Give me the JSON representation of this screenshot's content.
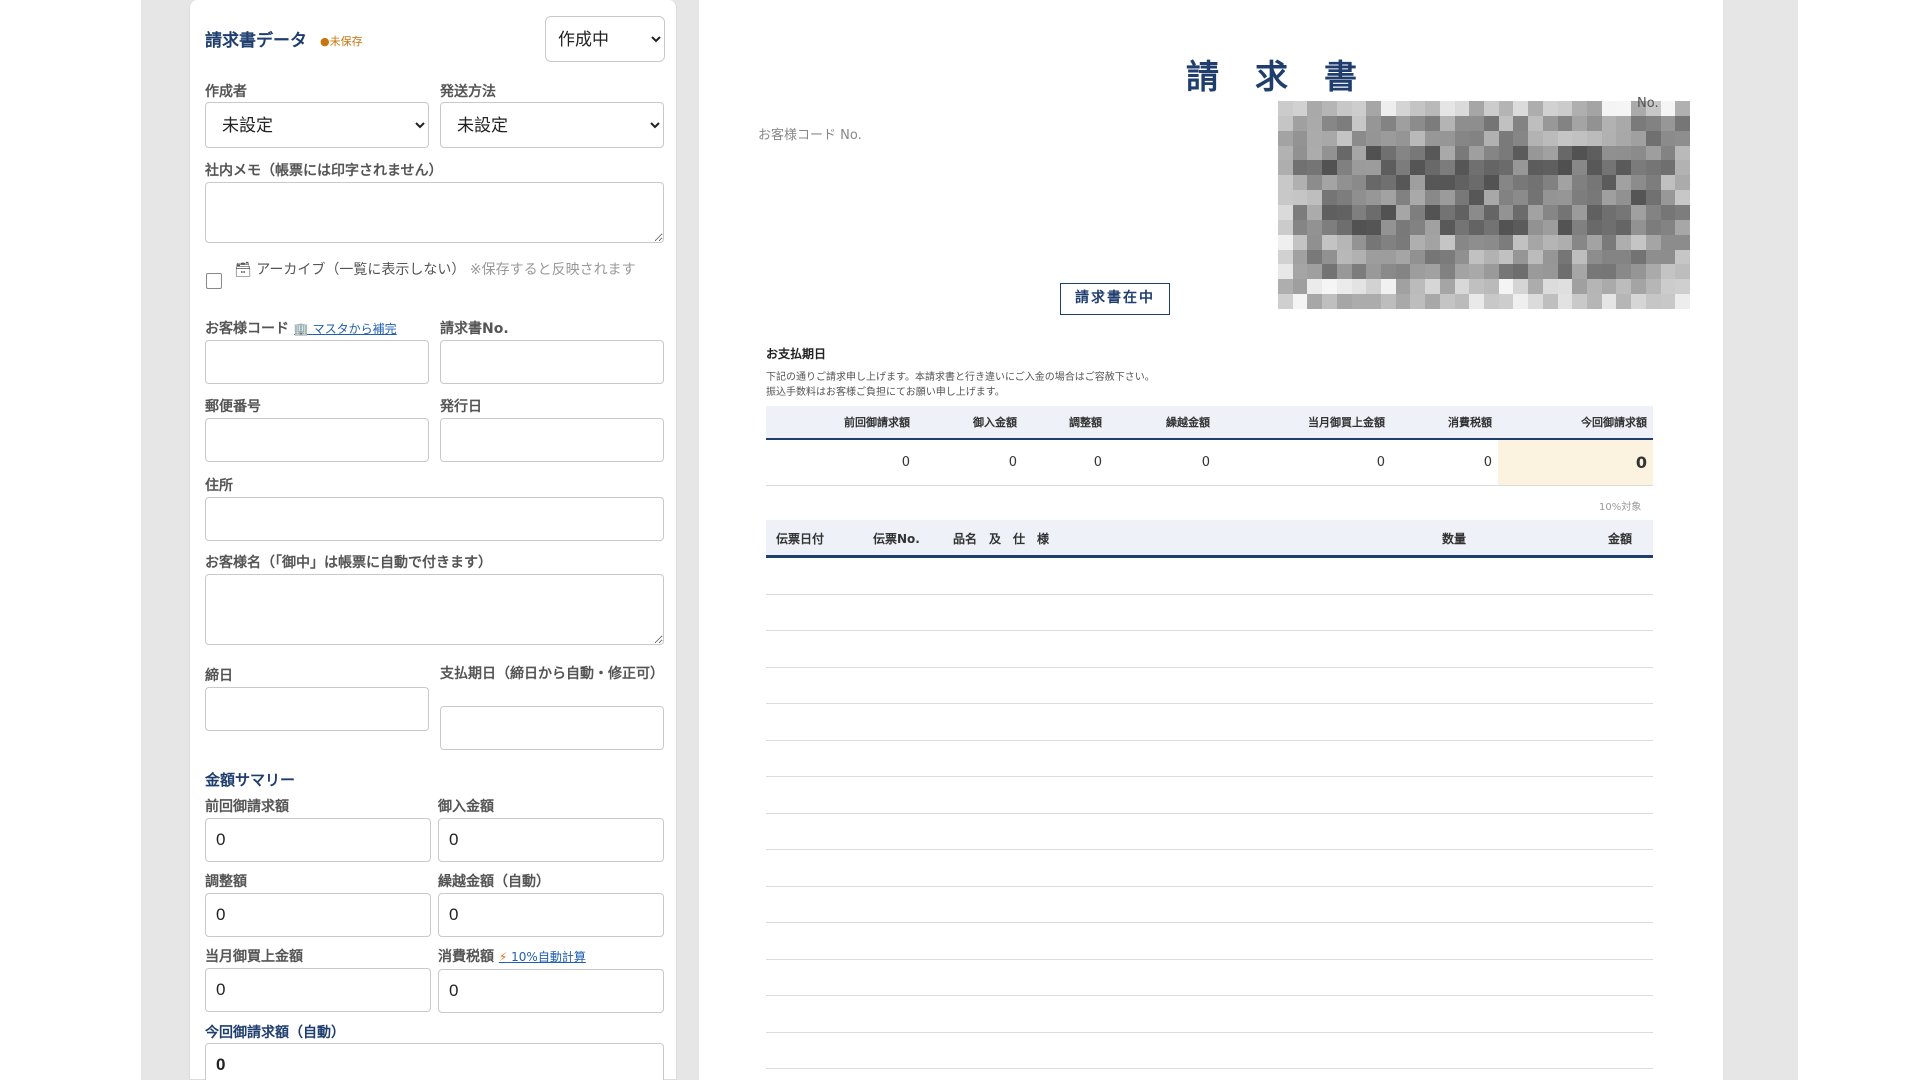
{
  "form": {
    "title": "請求書データ",
    "unsaved": "●未保存",
    "status": {
      "selected": "作成中"
    },
    "author": {
      "label": "作成者",
      "selected": "未設定"
    },
    "shipping": {
      "label": "発送方法",
      "selected": "未設定"
    },
    "memo": {
      "label": "社内メモ（帳票には印字されません）"
    },
    "archive": {
      "label": "アーカイブ（一覧に表示しない）",
      "hint": "※保存すると反映されます"
    },
    "customer_code": {
      "label": "お客様コード",
      "link": "マスタから補完"
    },
    "invoice_no": {
      "label": "請求書No."
    },
    "postal": {
      "label": "郵便番号"
    },
    "issue_date": {
      "label": "発行日"
    },
    "address": {
      "label": "住所"
    },
    "customer_name": {
      "label": "お客様名（「御中」は帳票に自動で付きます）"
    },
    "closing_date": {
      "label": "締日"
    },
    "due_date": {
      "label": "支払期日（締日から自動・修正可）"
    },
    "summary_title": "金額サマリー",
    "prev_amount": {
      "label": "前回御請求額",
      "value": "0"
    },
    "paid_amount": {
      "label": "御入金額",
      "value": "0"
    },
    "adjust": {
      "label": "調整額",
      "value": "0"
    },
    "carryover": {
      "label": "繰越金額（自動）",
      "value": "0"
    },
    "monthly_sales": {
      "label": "当月御買上金額",
      "value": "0"
    },
    "tax": {
      "label": "消費税額",
      "link": "10%自動計算",
      "value": "0"
    },
    "total": {
      "label": "今回御請求額（自動）",
      "value": "0"
    }
  },
  "invoice": {
    "title": "請求書",
    "customer_code_label": "お客様コード No.",
    "no_label": "No.",
    "stamp": "請求書在中",
    "due_label": "お支払期日",
    "note1": "下記の通りご請求申し上げます。本請求書と行き違いにご入金の場合はご容赦下さい。",
    "note2": "振込手数料はお客様ご負担にてお願い申し上げます。",
    "summary_headers": [
      "前回御請求額",
      "御入金額",
      "調整額",
      "繰越金額",
      "当月御買上金額",
      "消費税額",
      "今回御請求額"
    ],
    "summary_values": [
      "0",
      "0",
      "0",
      "0",
      "0",
      "0",
      "0"
    ],
    "tax_note": "10%対象",
    "item_headers": [
      "伝票日付",
      "伝票No.",
      "品名　及　仕　様",
      "数量",
      "金額"
    ]
  }
}
